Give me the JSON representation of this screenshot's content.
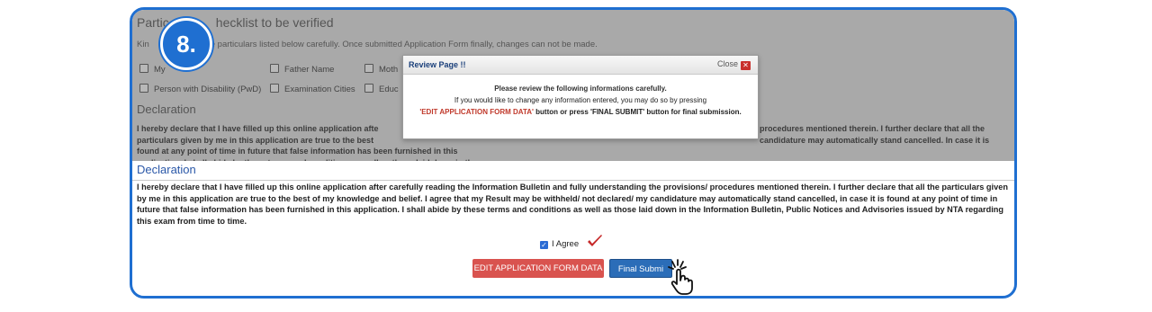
{
  "step_badge": "8.",
  "background_form": {
    "section_title": "Particulars checklist to be verified",
    "title_visible_start": "Partic",
    "title_visible_end": "hecklist to be verified",
    "note_visible_start": "Kin",
    "note_visible_end": "e particulars listed below carefully. Once submitted Application Form finally, changes can not be made.",
    "checkboxes_row1": [
      "My",
      "Father Name",
      "Moth"
    ],
    "checkboxes_row2": [
      "Person with Disability (PwD)",
      "Examination Cities",
      "Educ"
    ],
    "declaration_heading": "Declaration",
    "declaration_left": "I hereby declare that I have filled up this online application afte\nparticulars given by me in this application are true to the best\nfound at any point of time in future that false information has been furnished in this application. I shall abide by these terms and conditions as well as those laid down in the Information Bulletin, Public Notices\nand Advisories issued by NTA regarding this exam from time to time.",
    "declaration_right": "procedures mentioned therein. I further declare that all the\ncandidature may automatically stand cancelled. In case it is"
  },
  "declaration": {
    "heading": "Declaration",
    "text": "I hereby declare that I have filled up this online application after carefully reading the Information Bulletin and fully understanding the provisions/ procedures mentioned therein. I further declare that all the particulars given by me in this application are true to the best of my knowledge and belief. I agree that my Result may be withheld/ not declared/ my candidature may automatically stand cancelled, in case it is found at any point of time in future that false information has been furnished in this application. I shall abide by these terms and conditions as well as those laid down in the Information Bulletin, Public Notices and Advisories issued by NTA regarding this exam from time to time.",
    "agree_label": "I Agree",
    "agree_checked": true
  },
  "buttons": {
    "edit_label": "EDIT APPLICATION FORM DATA",
    "final_label": "Final Submi"
  },
  "modal": {
    "title": "Review Page !!",
    "close_label": "Close",
    "close_icon": "x-icon",
    "line1": "Please review the following informations carefully.",
    "line2": "If you would like to change any information entered, you may do so by pressing",
    "line3_red": "'EDIT APPLICATION FORM DATA'",
    "line3_rest": " button or press 'FINAL SUBMIT' button for final submission."
  },
  "colors": {
    "frame": "#1f6fd1",
    "edit_button": "#d9534f",
    "final_button": "#2b6db8",
    "heading_blue": "#2b58a8",
    "checkmark_red": "#c62828"
  },
  "icons": [
    "red-checkmark-icon",
    "pointer-hand-icon",
    "close-x-icon"
  ]
}
